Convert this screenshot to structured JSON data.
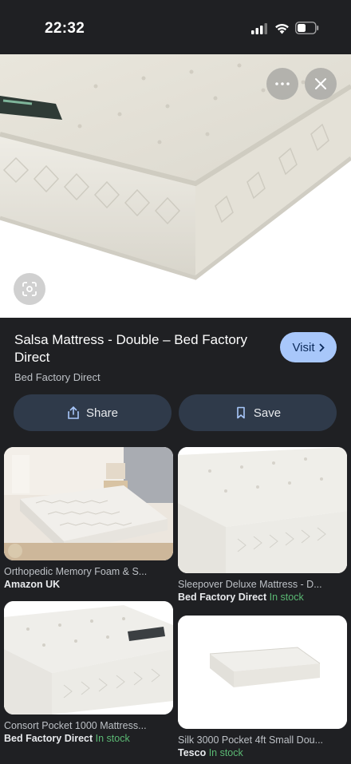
{
  "status_bar": {
    "time": "22:32"
  },
  "product": {
    "title": "Salsa Mattress - Double – Bed Factory Direct",
    "source": "Bed Factory Direct",
    "visit_label": "Visit",
    "share_label": "Share",
    "save_label": "Save"
  },
  "related": [
    {
      "name": "Orthopedic Memory Foam & S...",
      "store": "Amazon UK",
      "stock": ""
    },
    {
      "name": "Sleepover Deluxe Mattress - D...",
      "store": "Bed Factory Direct",
      "stock": "In stock"
    },
    {
      "name": "Consort Pocket 1000 Mattress...",
      "store": "Bed Factory Direct",
      "stock": "In stock"
    },
    {
      "name": "Silk 3000 Pocket 4ft Small Dou...",
      "store": "Tesco",
      "stock": "In stock"
    }
  ],
  "colors": {
    "accent": "#a8c7fa",
    "stock": "#5bb974",
    "background": "#1f2023"
  },
  "icons": {
    "more": "more-horizontal-icon",
    "close": "close-icon",
    "lens": "lens-icon",
    "share": "share-icon",
    "save": "bookmark-icon"
  }
}
